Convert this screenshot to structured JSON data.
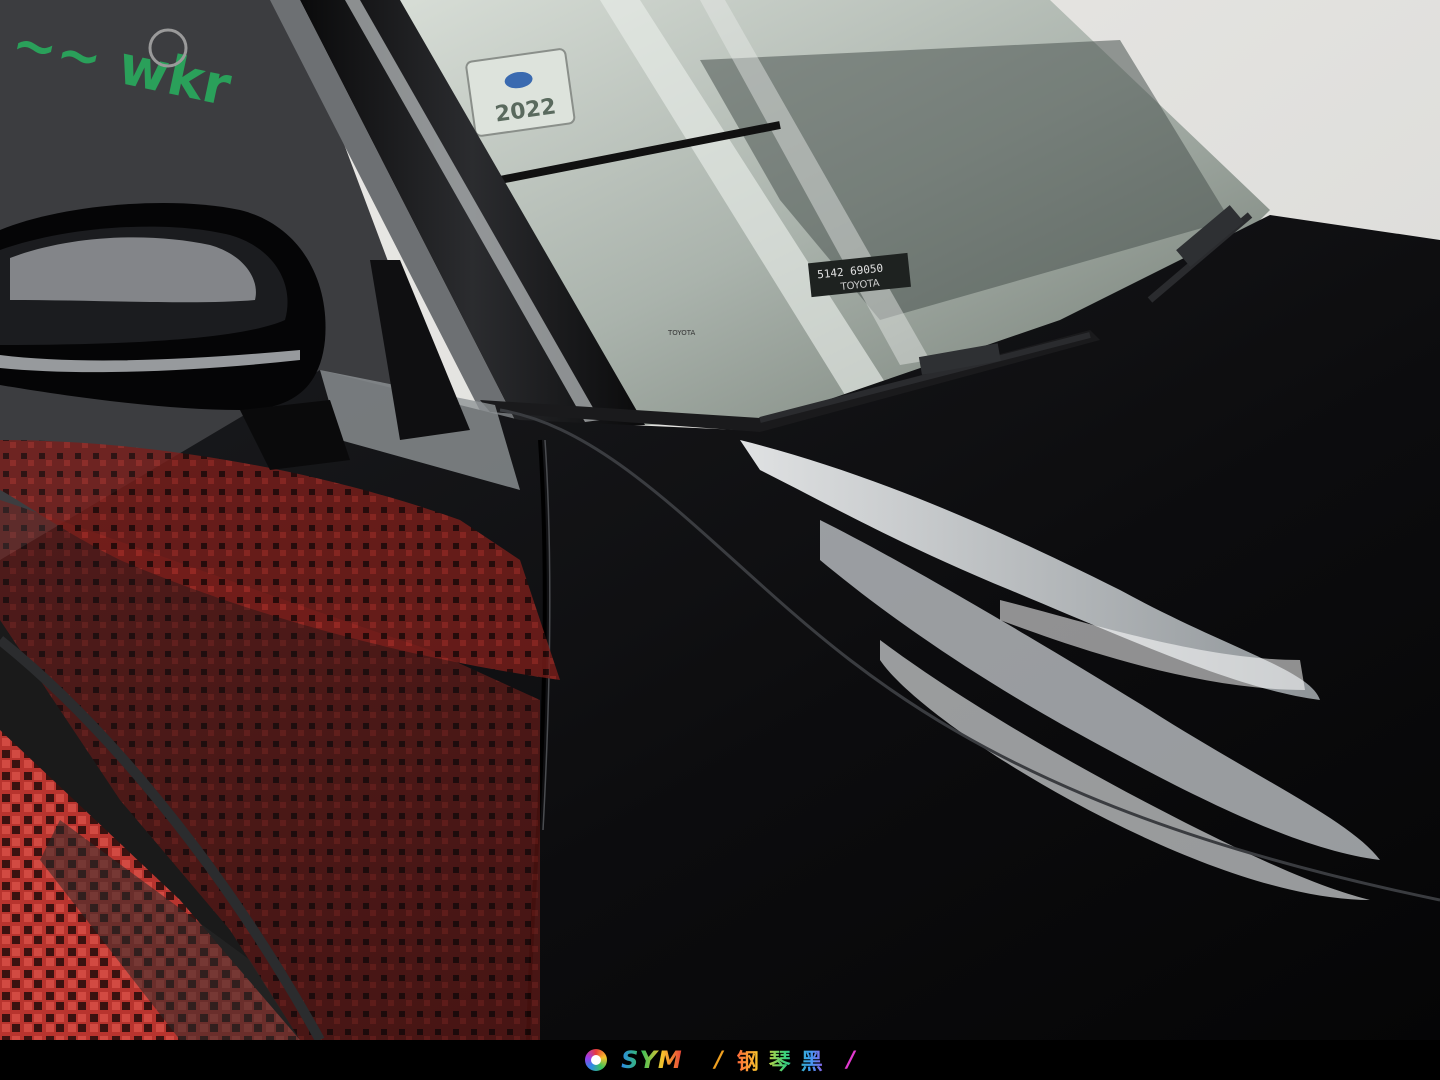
{
  "photo": {
    "subject": "black-car-hood-fender-windshield",
    "windshield_sticker_year": "2022",
    "windshield_sticker_brand": "TOYOTA",
    "windshield_code": "5142 69050",
    "wall_brand": "TOYOTA",
    "colors": {
      "paint": "#050507",
      "reflection": "#d8dde0",
      "mat": "#c23a32",
      "wall": "#e6e6e4",
      "glass": "#b9c2bb"
    }
  },
  "footer": {
    "brand": "SYM",
    "sep_left": "/",
    "tagline": "钢琴黑",
    "sep_right": "/"
  }
}
